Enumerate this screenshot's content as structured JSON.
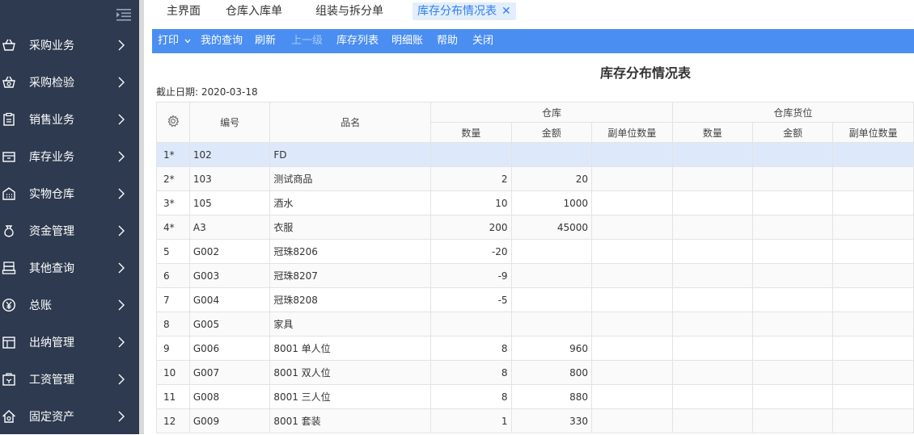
{
  "sidebar": {
    "items": [
      {
        "label": "采购业务",
        "icon": "basket-icon"
      },
      {
        "label": "采购检验",
        "icon": "inspection-basket-icon"
      },
      {
        "label": "销售业务",
        "icon": "clipboard-icon"
      },
      {
        "label": "库存业务",
        "icon": "box-icon"
      },
      {
        "label": "实物仓库",
        "icon": "warehouse-icon"
      },
      {
        "label": "资金管理",
        "icon": "money-bag-icon"
      },
      {
        "label": "其他查询",
        "icon": "database-icon"
      },
      {
        "label": "总账",
        "icon": "yen-icon"
      },
      {
        "label": "出纳管理",
        "icon": "cashier-icon"
      },
      {
        "label": "工资管理",
        "icon": "salary-icon"
      },
      {
        "label": "固定资产",
        "icon": "house-icon"
      }
    ]
  },
  "tabs": [
    {
      "label": "主界面"
    },
    {
      "label": "仓库入库单"
    },
    {
      "label": "组装与拆分单"
    },
    {
      "label": "库存分布情况表",
      "active": true,
      "close": "✕"
    }
  ],
  "toolbar": {
    "print": "打印",
    "my_query": "我的查询",
    "refresh": "刷新",
    "up_level": "上一级",
    "stock_list": "库存列表",
    "detail_ledger": "明细账",
    "help": "帮助",
    "close": "关闭"
  },
  "report": {
    "title": "库存分布情况表",
    "cutoff": "截止日期: 2020-03-18"
  },
  "table": {
    "headers": {
      "code": "编号",
      "name": "品名",
      "warehouse_group": "仓库",
      "location_group": "仓库货位",
      "qty": "数量",
      "amount": "金额",
      "sub_qty": "副单位数量"
    },
    "rows": [
      {
        "no": "1*",
        "code": "102",
        "name": "FD",
        "qty": "",
        "amount": "",
        "selected": true
      },
      {
        "no": "2*",
        "code": "103",
        "name": "测试商品",
        "qty": "2",
        "amount": "20"
      },
      {
        "no": "3*",
        "code": "105",
        "name": "酒水",
        "qty": "10",
        "amount": "1000"
      },
      {
        "no": "4*",
        "code": "A3",
        "name": "衣服",
        "qty": "200",
        "amount": "45000"
      },
      {
        "no": "5",
        "code": "G002",
        "name": "冠珠8206",
        "qty": "-20",
        "amount": ""
      },
      {
        "no": "6",
        "code": "G003",
        "name": "冠珠8207",
        "qty": "-9",
        "amount": ""
      },
      {
        "no": "7",
        "code": "G004",
        "name": "冠珠8208",
        "qty": "-5",
        "amount": ""
      },
      {
        "no": "8",
        "code": "G005",
        "name": "家具",
        "qty": "",
        "amount": ""
      },
      {
        "no": "9",
        "code": "G006",
        "name": "8001 单人位",
        "qty": "8",
        "amount": "960"
      },
      {
        "no": "10",
        "code": "G007",
        "name": "8001 双人位",
        "qty": "8",
        "amount": "800"
      },
      {
        "no": "11",
        "code": "G008",
        "name": "8001 三人位",
        "qty": "8",
        "amount": "880"
      },
      {
        "no": "12",
        "code": "G009",
        "name": "8001 套装",
        "qty": "1",
        "amount": "330"
      }
    ]
  }
}
